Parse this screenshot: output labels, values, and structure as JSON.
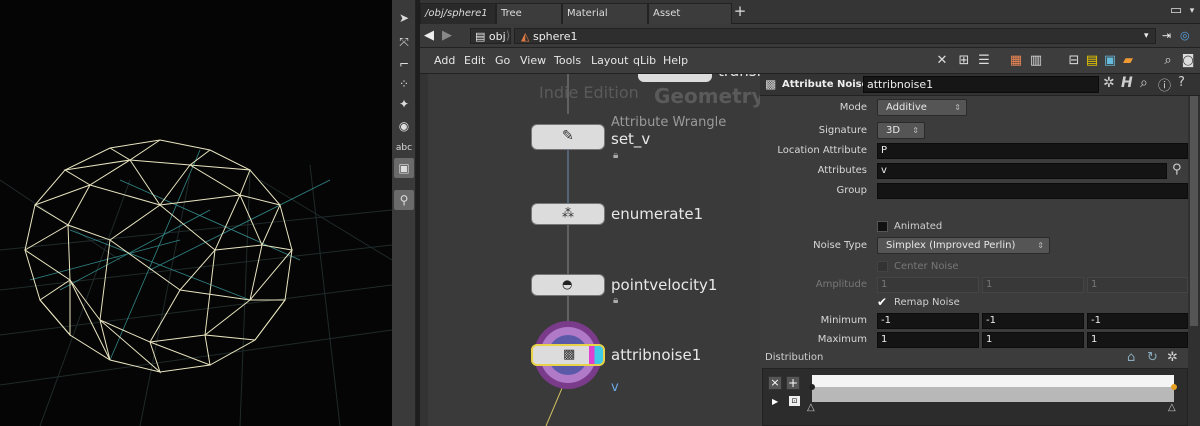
{
  "tabs": [
    {
      "label": "/obj/sphere1",
      "active": true
    },
    {
      "label": "Tree View",
      "active": false
    },
    {
      "label": "Material Palette",
      "active": false
    },
    {
      "label": "Asset Browser",
      "active": false
    }
  ],
  "path": {
    "root": "obj",
    "current": "sphere1"
  },
  "menu": [
    "Add",
    "Edit",
    "Go",
    "View",
    "Tools",
    "Layout",
    "qLib",
    "Help"
  ],
  "lefttools": {
    "abc_label": "abc"
  },
  "network": {
    "watermark_edition": "Indie Edition",
    "watermark_context": "Geometry",
    "top_node_partial": "transf",
    "nodes": [
      {
        "name": "set_v",
        "type": "Attribute Wrangle",
        "locked": true
      },
      {
        "name": "enumerate1",
        "type": "",
        "locked": false
      },
      {
        "name": "pointvelocity1",
        "type": "",
        "locked": true
      },
      {
        "name": "attribnoise1",
        "type": "",
        "locked": false,
        "group_hint": "v"
      }
    ]
  },
  "params": {
    "node_type": "Attribute Noise",
    "node_name": "attribnoise1",
    "mode": {
      "label": "Mode",
      "value": "Additive"
    },
    "signature": {
      "label": "Signature",
      "value": "3D"
    },
    "location": {
      "label": "Location Attribute",
      "value": "P"
    },
    "attributes": {
      "label": "Attributes",
      "value": "v"
    },
    "group": {
      "label": "Group",
      "value": ""
    },
    "animated": {
      "label": "Animated",
      "checked": false
    },
    "noise_type": {
      "label": "Noise Type",
      "value": "Simplex (Improved Perlin)"
    },
    "center_noise": {
      "label": "Center Noise",
      "checked": false
    },
    "amplitude": {
      "label": "Amplitude",
      "values": [
        "1",
        "1",
        "1"
      ]
    },
    "remap": {
      "label": "Remap Noise",
      "checked": true
    },
    "minimum": {
      "label": "Minimum",
      "values": [
        "-1",
        "-1",
        "-1"
      ]
    },
    "maximum": {
      "label": "Maximum",
      "values": [
        "1",
        "1",
        "1"
      ]
    },
    "distribution": {
      "label": "Distribution"
    }
  }
}
